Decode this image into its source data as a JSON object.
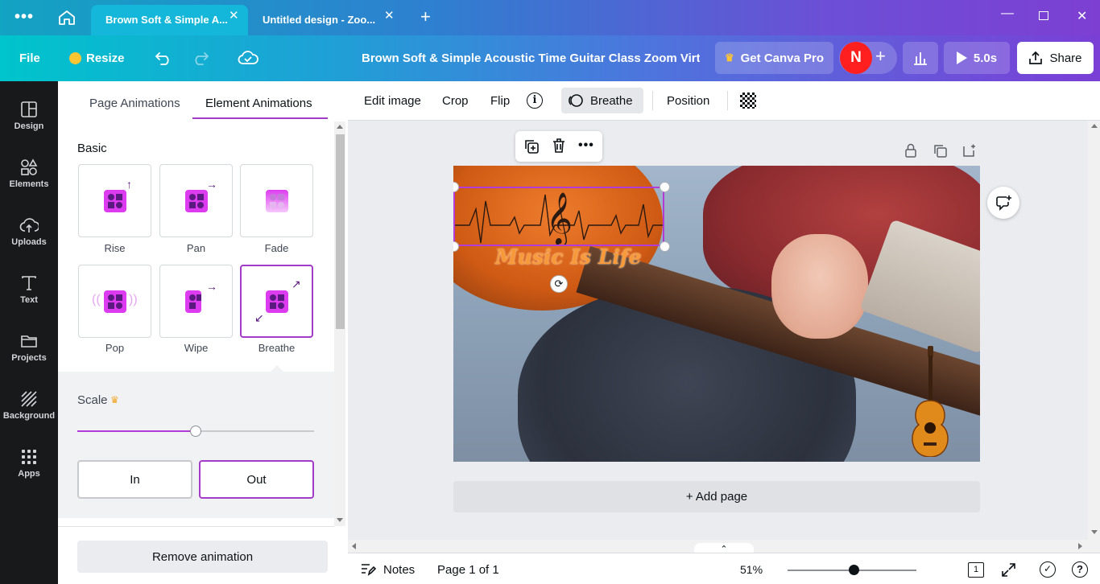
{
  "tabs": [
    {
      "label": "Brown Soft & Simple A..."
    },
    {
      "label": "Untitled design - Zoo..."
    }
  ],
  "toolbar": {
    "file_label": "File",
    "resize_label": "Resize",
    "doc_title": "Brown Soft & Simple Acoustic Time Guitar Class Zoom Virtu...",
    "canva_pro_label": "Get Canva Pro",
    "avatar_initial": "N",
    "duration_label": "5.0s",
    "share_label": "Share"
  },
  "sidebar": {
    "items": [
      {
        "label": "Design",
        "icon": "design-icon"
      },
      {
        "label": "Elements",
        "icon": "elements-icon"
      },
      {
        "label": "Uploads",
        "icon": "uploads-icon"
      },
      {
        "label": "Text",
        "icon": "text-icon"
      },
      {
        "label": "Projects",
        "icon": "projects-icon"
      },
      {
        "label": "Background",
        "icon": "background-icon"
      },
      {
        "label": "Apps",
        "icon": "apps-icon"
      }
    ]
  },
  "panel": {
    "tabs": [
      {
        "label": "Page Animations"
      },
      {
        "label": "Element Animations"
      }
    ],
    "section_title": "Basic",
    "animations": [
      {
        "label": "Rise"
      },
      {
        "label": "Pan"
      },
      {
        "label": "Fade"
      },
      {
        "label": "Pop"
      },
      {
        "label": "Wipe"
      },
      {
        "label": "Breathe"
      }
    ],
    "selected_animation": "Breathe",
    "scale_label": "Scale",
    "scale_value_fraction": 0.5,
    "in_label": "In",
    "out_label": "Out",
    "remove_label": "Remove animation"
  },
  "editbar": {
    "edit_image": "Edit image",
    "crop": "Crop",
    "flip": "Flip",
    "breathe": "Breathe",
    "position": "Position"
  },
  "canvas": {
    "overlay_text": "Music Is Life",
    "add_page_label": "+ Add page"
  },
  "bottombar": {
    "notes_label": "Notes",
    "page_label": "Page 1 of 1",
    "zoom_label": "51%",
    "zoom_fraction": 0.51,
    "page_count": "1"
  },
  "colors": {
    "accent": "#a23bc8",
    "selection": "#b33cd9"
  }
}
